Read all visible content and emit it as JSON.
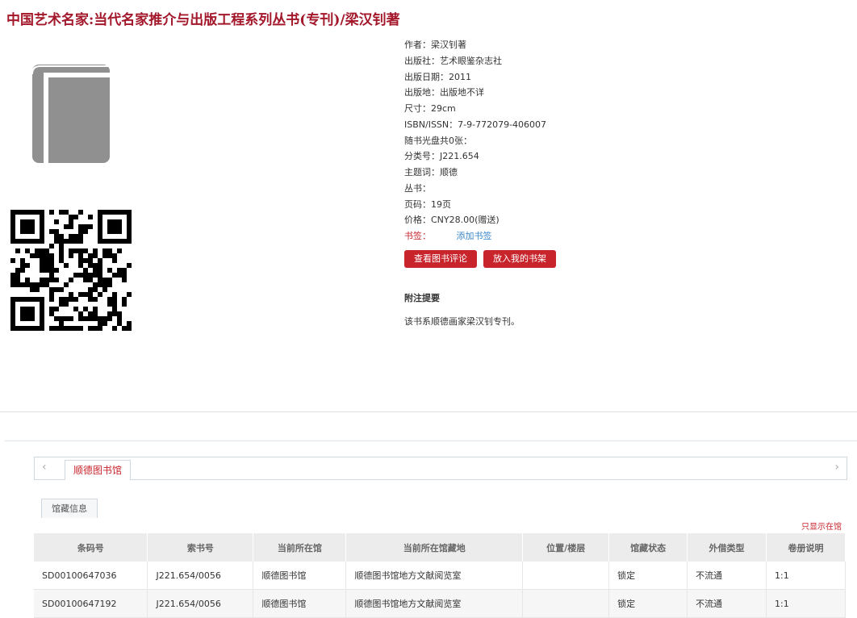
{
  "title": "中国艺术名家:当代名家推介与出版工程系列丛书(专刊)/梁汉钊著",
  "meta": {
    "author": "作者：梁汉钊著",
    "publisher": "出版社：艺术眼鉴杂志社",
    "date": "出版日期：2011",
    "place": "出版地：出版地不详",
    "size": "尺寸：29cm",
    "isbn": "ISBN/ISSN：7-9-772079-406007",
    "cd": "随书光盘共0张：",
    "classno": "分类号：J221.654",
    "subject": "主题词：顺德",
    "series": "丛书：",
    "pages": "页码：19页",
    "price": "价格：CNY28.00(赠送)",
    "bookmark_label": "书签：",
    "bookmark_link": "添加书签"
  },
  "buttons": {
    "review": "查看图书评论",
    "shelf": "放入我的书架"
  },
  "note": {
    "heading": "附注提要",
    "body": "该书系顺德画家梁汉钊专刊。"
  },
  "holdings": {
    "tab": "顺德图书馆",
    "subtab": "馆藏信息",
    "only_available": "只显示在馆",
    "headers": [
      "条码号",
      "索书号",
      "当前所在馆",
      "当前所在馆藏地",
      "位置/楼层",
      "馆藏状态",
      "外借类型",
      "卷册说明"
    ],
    "rows": [
      [
        "SD00100647036",
        "J221.654/0056",
        "顺德图书馆",
        "顺德图书馆地方文献阅览室",
        "",
        "锁定",
        "不流通",
        "1:1"
      ],
      [
        "SD00100647192",
        "J221.654/0056",
        "顺德图书馆",
        "顺德图书馆地方文献阅览室",
        "",
        "锁定",
        "不流通",
        "1:1"
      ]
    ]
  },
  "colors": {
    "accent": "#c8242c",
    "title": "#a3182a",
    "link": "#3a86c8"
  },
  "icons": {
    "cover": "book-icon",
    "qr": "qr-code",
    "prev": "chevron-left-icon",
    "next": "chevron-right-icon"
  }
}
